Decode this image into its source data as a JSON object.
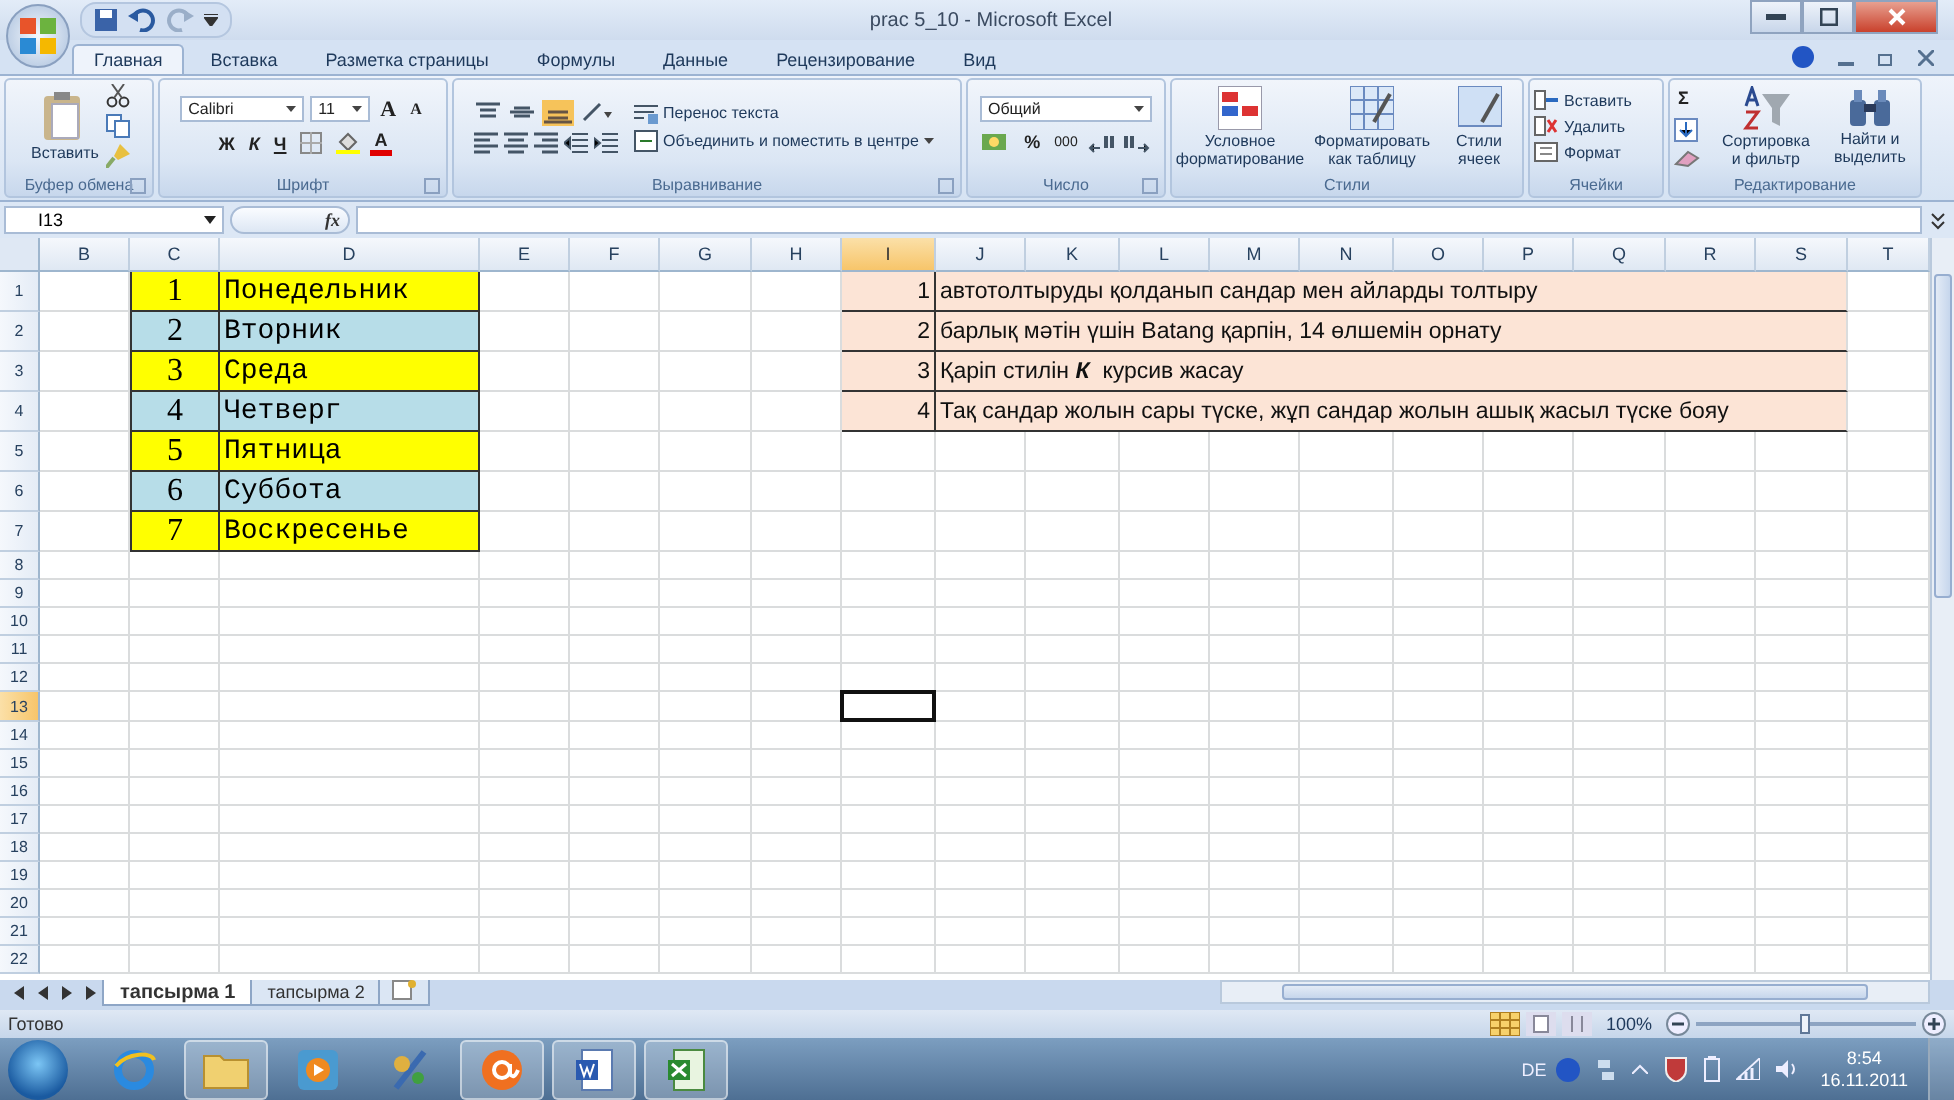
{
  "window": {
    "title": "prac 5_10 - Microsoft Excel"
  },
  "ribbon_tabs": [
    {
      "label": "Главная",
      "selected": true
    },
    {
      "label": "Вставка",
      "selected": false
    },
    {
      "label": "Разметка страницы",
      "selected": false
    },
    {
      "label": "Формулы",
      "selected": false
    },
    {
      "label": "Данные",
      "selected": false
    },
    {
      "label": "Рецензирование",
      "selected": false
    },
    {
      "label": "Вид",
      "selected": false
    }
  ],
  "ribbon": {
    "clipboard": {
      "label": "Буфер обмена",
      "paste": "Вставить"
    },
    "font": {
      "label": "Шрифт",
      "family": "Calibri",
      "size": "11",
      "grow": "A",
      "shrink": "A",
      "bold": "Ж",
      "italic": "К",
      "underline": "Ч",
      "font_color": "A"
    },
    "alignment": {
      "label": "Выравнивание",
      "wrap": "Перенос текста",
      "merge": "Объединить и поместить в центре"
    },
    "number": {
      "label": "Число",
      "format": "Общий",
      "percent": "%",
      "thousands": "000"
    },
    "styles": {
      "label": "Стили",
      "conditional": "Условное форматирование",
      "as_table": "Форматировать как таблицу",
      "cell_styles": "Стили ячеек"
    },
    "cells": {
      "label": "Ячейки",
      "insert": "Вставить",
      "delete": "Удалить",
      "format": "Формат"
    },
    "editing": {
      "label": "Редактирование",
      "sum": "Σ",
      "sort": "Сортировка и фильтр",
      "find": "Найти и выделить"
    }
  },
  "formula_bar": {
    "name_box": "I13",
    "function_label": "fx"
  },
  "columns": [
    {
      "label": "B",
      "selected": false
    },
    {
      "label": "C",
      "selected": false
    },
    {
      "label": "D",
      "selected": false
    },
    {
      "label": "E",
      "selected": false
    },
    {
      "label": "F",
      "selected": false
    },
    {
      "label": "G",
      "selected": false
    },
    {
      "label": "H",
      "selected": false
    },
    {
      "label": "I",
      "selected": true
    },
    {
      "label": "J",
      "selected": false
    },
    {
      "label": "K",
      "selected": false
    },
    {
      "label": "L",
      "selected": false
    },
    {
      "label": "M",
      "selected": false
    },
    {
      "label": "N",
      "selected": false
    },
    {
      "label": "O",
      "selected": false
    },
    {
      "label": "P",
      "selected": false
    },
    {
      "label": "Q",
      "selected": false
    },
    {
      "label": "R",
      "selected": false
    },
    {
      "label": "S",
      "selected": false
    },
    {
      "label": "T",
      "selected": false
    }
  ],
  "rows": [
    {
      "number": "1",
      "selected": false,
      "day": {
        "index": "1",
        "name": "Понедельник",
        "color": "#ffff00"
      },
      "task": {
        "index": "1",
        "text": "автотолтыруды қолданып сандар мен айларды толтыру"
      }
    },
    {
      "number": "2",
      "selected": false,
      "day": {
        "index": "2",
        "name": "Вторник",
        "color": "#b7dde8"
      },
      "task": {
        "index": "2",
        "text": "барлық мәтін үшін Batang қарпін, 14 өлшемін орнату"
      }
    },
    {
      "number": "3",
      "selected": false,
      "day": {
        "index": "3",
        "name": "Среда",
        "color": "#ffff00"
      },
      "task": {
        "index": "3",
        "text": "Қаріп стилін **К**  курсив жасау"
      }
    },
    {
      "number": "4",
      "selected": false,
      "day": {
        "index": "4",
        "name": "Четверг",
        "color": "#b7dde8"
      },
      "task": {
        "index": "4",
        "text": "Тақ сандар жолын сары түске, жұп сандар жолын ашық жасыл түске бояу"
      }
    },
    {
      "number": "5",
      "selected": false,
      "day": {
        "index": "5",
        "name": "Пятница",
        "color": "#ffff00"
      }
    },
    {
      "number": "6",
      "selected": false,
      "day": {
        "index": "6",
        "name": "Суббота",
        "color": "#b7dde8"
      }
    },
    {
      "number": "7",
      "selected": false,
      "day": {
        "index": "7",
        "name": "Воскресенье",
        "color": "#ffff00"
      }
    },
    {
      "number": "8",
      "selected": false
    },
    {
      "number": "9",
      "selected": false
    },
    {
      "number": "10",
      "selected": false
    },
    {
      "number": "11",
      "selected": false
    },
    {
      "number": "12",
      "selected": false
    },
    {
      "number": "13",
      "selected": true
    },
    {
      "number": "14",
      "selected": false
    },
    {
      "number": "15",
      "selected": false
    },
    {
      "number": "16",
      "selected": false
    },
    {
      "number": "17",
      "selected": false
    },
    {
      "number": "18",
      "selected": false
    },
    {
      "number": "19",
      "selected": false
    },
    {
      "number": "20",
      "selected": false
    },
    {
      "number": "21",
      "selected": false
    },
    {
      "number": "22",
      "selected": false
    }
  ],
  "sheet_tabs": [
    {
      "label": "тапсырма 1",
      "selected": true
    },
    {
      "label": "тапсырма 2",
      "selected": false
    }
  ],
  "status_bar": {
    "status": "Готово",
    "zoom": "100%",
    "zoom_level": {
      "level": 0.5
    }
  },
  "taskbar": {
    "apps": [
      {
        "kind": "browser",
        "running": false
      },
      {
        "kind": "folder",
        "running": true
      },
      {
        "kind": "media",
        "running": false
      },
      {
        "kind": "paint",
        "running": false
      },
      {
        "kind": "mail",
        "running": true
      },
      {
        "kind": "word",
        "running": true
      },
      {
        "kind": "excel",
        "running": true
      }
    ],
    "language": "DE",
    "time": "8:54",
    "date": "16.11.2011"
  }
}
